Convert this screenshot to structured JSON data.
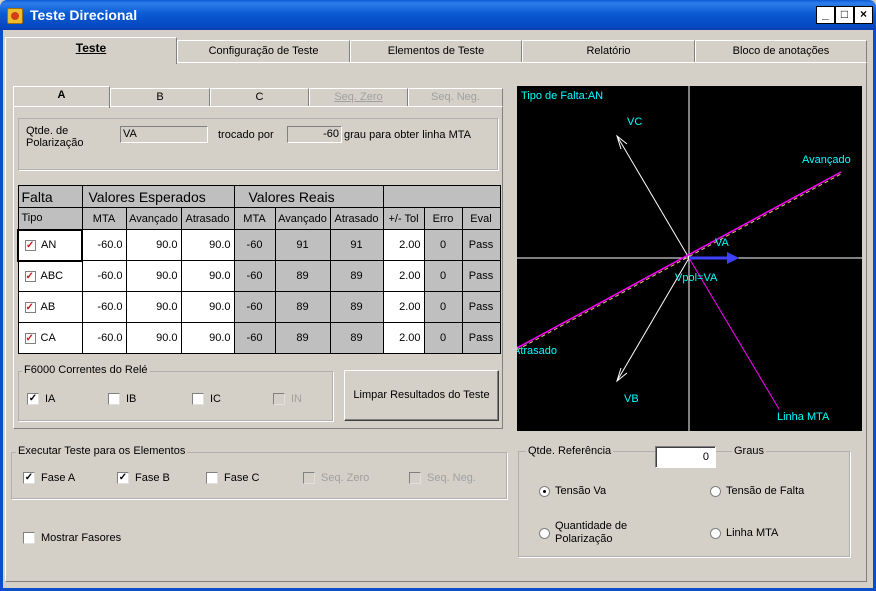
{
  "window": {
    "title": "Teste Direcional",
    "buttons": {
      "minimize": "_",
      "maximize": "□",
      "close": "×"
    }
  },
  "main_tabs": [
    {
      "label": "Teste",
      "active": true
    },
    {
      "label": "Configuração de Teste"
    },
    {
      "label": "Elementos de Teste"
    },
    {
      "label": "Relatório"
    },
    {
      "label": "Bloco de anotações"
    }
  ],
  "sub_tabs": [
    {
      "label": "A",
      "active": true,
      "enabled": true
    },
    {
      "label": "B",
      "enabled": true
    },
    {
      "label": "C",
      "enabled": true
    },
    {
      "label": "Seq. Zero",
      "enabled": false
    },
    {
      "label": "Seq. Neg.",
      "enabled": false
    }
  ],
  "polarization": {
    "label": "Qtde. de Polarização",
    "value": "VA",
    "swapped_label": "trocado por",
    "degrees": "-60",
    "suffix": "grau para obter linha MTA"
  },
  "table": {
    "group_headers": {
      "falta": "Falta",
      "esperados": "Valores Esperados",
      "reais": "Valores Reais"
    },
    "headers": [
      "Tipo",
      "MTA",
      "Avançado",
      "Atrasado",
      "MTA",
      "Avançado",
      "Atrasado",
      "+/- Tol",
      "Erro",
      "Eval"
    ],
    "rows": [
      {
        "tipo": "AN",
        "mta": "-60.0",
        "avancado": "90.0",
        "atrasado": "90.0",
        "r_mta": "-60",
        "r_avancado": "91",
        "r_atrasado": "91",
        "tol": "2.00",
        "erro": "0",
        "eval": "Pass"
      },
      {
        "tipo": "ABC",
        "mta": "-60.0",
        "avancado": "90.0",
        "atrasado": "90.0",
        "r_mta": "-60",
        "r_avancado": "89",
        "r_atrasado": "89",
        "tol": "2.00",
        "erro": "0",
        "eval": "Pass"
      },
      {
        "tipo": "AB",
        "mta": "-60.0",
        "avancado": "90.0",
        "atrasado": "90.0",
        "r_mta": "-60",
        "r_avancado": "89",
        "r_atrasado": "89",
        "tol": "2.00",
        "erro": "0",
        "eval": "Pass"
      },
      {
        "tipo": "CA",
        "mta": "-60.0",
        "avancado": "90.0",
        "atrasado": "90.0",
        "r_mta": "-60",
        "r_avancado": "89",
        "r_atrasado": "89",
        "tol": "2.00",
        "erro": "0",
        "eval": "Pass"
      }
    ]
  },
  "relay_currents": {
    "title": "F6000 Correntes do Relé",
    "items": [
      {
        "label": "IA",
        "checked": true,
        "enabled": true
      },
      {
        "label": "IB",
        "checked": false,
        "enabled": true
      },
      {
        "label": "IC",
        "checked": false,
        "enabled": true
      },
      {
        "label": "IN",
        "checked": false,
        "enabled": false
      }
    ]
  },
  "clear_button": "Limpar Resultados do Teste",
  "execute": {
    "title": "Executar Teste para os Elementos",
    "items": [
      {
        "label": "Fase A",
        "checked": true,
        "enabled": true
      },
      {
        "label": "Fase B",
        "checked": true,
        "enabled": true
      },
      {
        "label": "Fase C",
        "checked": false,
        "enabled": true
      },
      {
        "label": "Seq. Zero",
        "checked": false,
        "enabled": false
      },
      {
        "label": "Seq. Neg.",
        "checked": false,
        "enabled": false
      }
    ]
  },
  "show_phasors": {
    "label": "Mostrar Fasores",
    "checked": false
  },
  "plot": {
    "fault_type": "Tipo de Falta:AN",
    "labels": {
      "vc": "VC",
      "vb": "VB",
      "va": "VA",
      "vpol": "Vpol=VA",
      "forward": "Avançado",
      "reverse": "Atrasado",
      "mta_line": "Linha MTA"
    },
    "colors": {
      "background": "#000000",
      "axes": "#ffffff",
      "phasors": "#ffffff",
      "boundary": "#ff00ff",
      "boundary_dash": "#e8c070",
      "vpol": "#4040ff",
      "text": "#00ffff"
    }
  },
  "reference": {
    "title": "Qtde. Referência",
    "value": "0",
    "unit": "Graus",
    "options": [
      {
        "label": "Tensão Va",
        "selected": true
      },
      {
        "label": "Tensão de Falta",
        "selected": false
      },
      {
        "label": "Quantidade de Polarização",
        "selected": false
      },
      {
        "label": "Linha MTA",
        "selected": false
      }
    ]
  }
}
